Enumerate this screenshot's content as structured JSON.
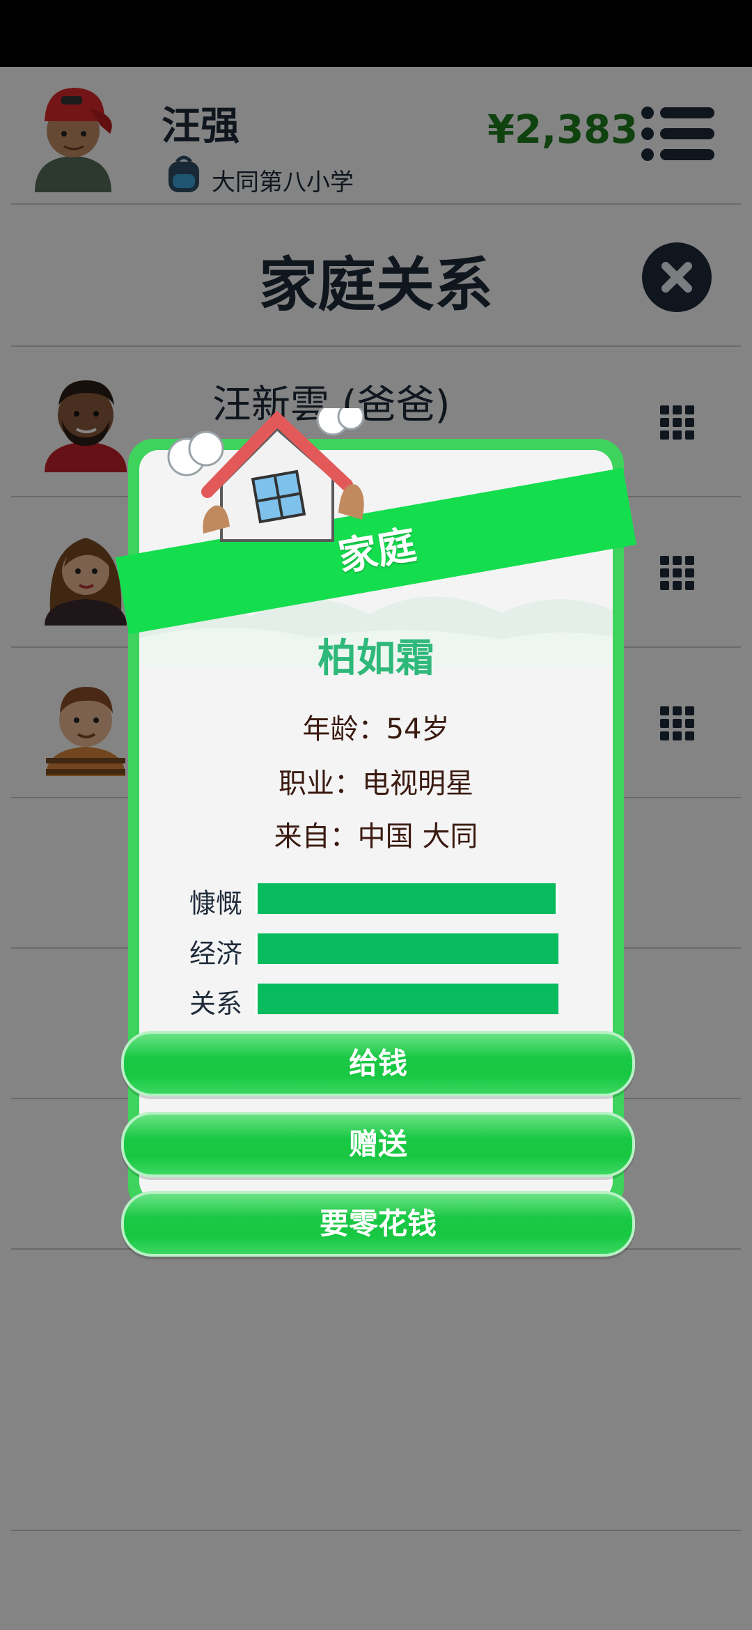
{
  "header": {
    "player_name": "汪强",
    "school": "大同第八小学",
    "money": "¥2,383"
  },
  "page": {
    "title": "家庭关系"
  },
  "members": [
    {
      "name": "汪新雲 (爸爸)"
    },
    {
      "name": ""
    },
    {
      "name": ""
    }
  ],
  "modal": {
    "banner": "家庭",
    "person_name": "柏如霜",
    "age": "年龄：54岁",
    "job": "职业：电视明星",
    "origin": "来自：中国 大同",
    "stats": [
      {
        "label": "慷慨",
        "value": 0.99
      },
      {
        "label": "经济",
        "value": 1.0
      },
      {
        "label": "关系",
        "value": 1.0
      }
    ],
    "actions": [
      "给钱",
      "赠送",
      "要零花钱"
    ]
  },
  "colors": {
    "accent_green": "#14dd4e",
    "money_green": "#1f7d1f",
    "stat_green": "#08bb5c",
    "name_teal": "#2eb87a",
    "dark_navy": "#1f2b3a"
  }
}
